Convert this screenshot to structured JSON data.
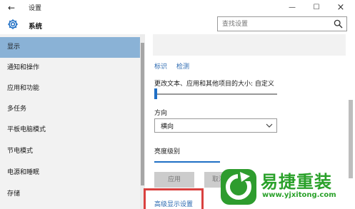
{
  "window": {
    "title": "设置",
    "back_glyph": "←",
    "minimize_glyph": "—",
    "maximize_glyph": "☐",
    "close_glyph": "×"
  },
  "header": {
    "title": "系统",
    "icon": "gear-icon",
    "search_placeholder": "查找设置",
    "search_icon": "search-icon"
  },
  "sidebar": {
    "items": [
      {
        "label": "显示",
        "selected": true
      },
      {
        "label": "通知和操作",
        "selected": false
      },
      {
        "label": "应用和功能",
        "selected": false
      },
      {
        "label": "多任务",
        "selected": false
      },
      {
        "label": "平板电脑模式",
        "selected": false
      },
      {
        "label": "节电模式",
        "selected": false
      },
      {
        "label": "电源和睡眠",
        "selected": false
      },
      {
        "label": "存储",
        "selected": false
      }
    ]
  },
  "main": {
    "links": {
      "identify": "标识",
      "detect": "检测"
    },
    "scale": {
      "label": "更改文本、应用和其他项目的大小: 自定义",
      "value_fraction": 0.0
    },
    "orientation": {
      "label": "方向",
      "value": "横向"
    },
    "brightness": {
      "label": "亮度级别"
    },
    "buttons": {
      "apply": "应用",
      "cancel": "取消"
    },
    "advanced_link": "高级显示设置"
  },
  "colors": {
    "selected_nav": "#8ab2d6",
    "accent": "#1f6fc5",
    "link": "#2a68b0",
    "highlight": "#d9413f",
    "watermark": "#2aa12a"
  },
  "watermark": {
    "title": "易捷重装",
    "url": "www.yjxitong.com",
    "icon": "refresh-logo-icon"
  }
}
